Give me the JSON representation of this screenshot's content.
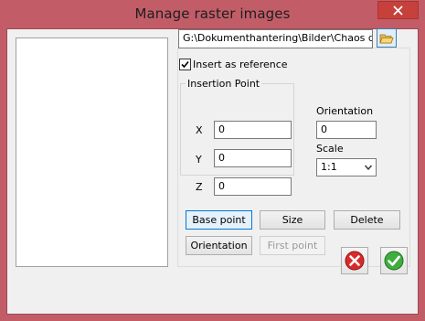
{
  "window": {
    "title": "Manage raster images"
  },
  "file": {
    "path": "G:\\Dokumenthantering\\Bilder\\Chaos deskt"
  },
  "options": {
    "insert_as_reference_label": "Insert as reference",
    "insert_as_reference_checked": true
  },
  "insertion_point": {
    "legend": "Insertion Point",
    "x_label": "X",
    "x_value": "0",
    "y_label": "Y",
    "y_value": "0",
    "z_label": "Z",
    "z_value": "0"
  },
  "orientation": {
    "label": "Orientation",
    "value": "0"
  },
  "scale": {
    "label": "Scale",
    "value": "1:1"
  },
  "buttons": {
    "base_point": "Base point",
    "size": "Size",
    "delete": "Delete",
    "orientation": "Orientation",
    "first_point": "First point"
  },
  "icons": {
    "close": "close-icon",
    "folder": "folder-open-icon",
    "cancel": "cancel-icon",
    "ok": "ok-icon"
  },
  "colors": {
    "title_bar": "#c25d68",
    "close_button": "#c7413c",
    "active_button_border": "#0078d7"
  }
}
